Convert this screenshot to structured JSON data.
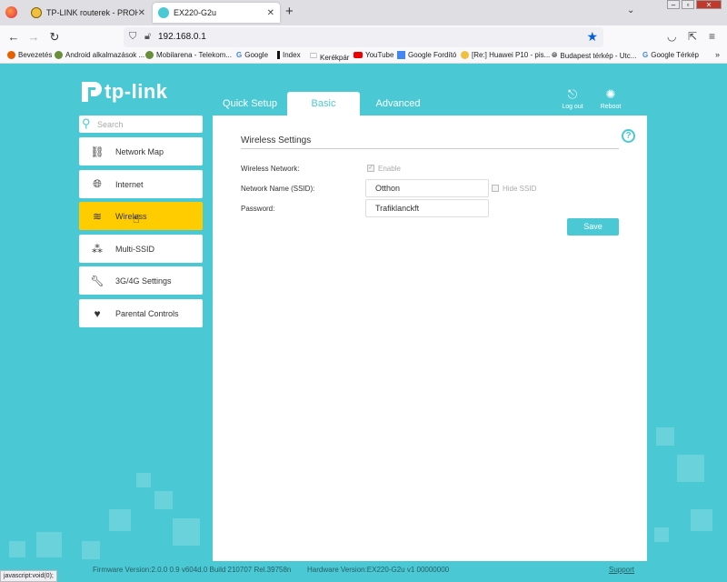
{
  "browser": {
    "tabs": [
      {
        "title": "TP-LINK routerek - PROHARDVER",
        "active": false
      },
      {
        "title": "EX220-G2u",
        "active": true
      }
    ],
    "new_tab": "+",
    "url": "192.168.0.1",
    "bookmarks": [
      {
        "label": "Bevezetés",
        "icon": "firefox-icon"
      },
      {
        "label": "Android alkalmazások ...",
        "icon": "mobilarena-icon"
      },
      {
        "label": "Mobilarena - Telekom...",
        "icon": "mobilarena-icon"
      },
      {
        "label": "Google",
        "icon": "google-icon"
      },
      {
        "label": "Index",
        "icon": "index-icon"
      },
      {
        "label": "Kerékpár",
        "icon": "folder-icon"
      },
      {
        "label": "YouTube",
        "icon": "youtube-icon"
      },
      {
        "label": "Google Fordító",
        "icon": "translate-icon"
      },
      {
        "label": "[Re:] Huawei P10 - pis...",
        "icon": "mobilarena-icon"
      },
      {
        "label": "Budapest térkép - Utc...",
        "icon": "globe-icon"
      },
      {
        "label": "Google Térkép",
        "icon": "google-icon"
      }
    ],
    "status_text": "javascript:void(0);"
  },
  "router": {
    "brand": "tp-link",
    "nav_tabs": [
      {
        "label": "Quick Setup",
        "active": false
      },
      {
        "label": "Basic",
        "active": true
      },
      {
        "label": "Advanced",
        "active": false
      }
    ],
    "logout_label": "Log out",
    "reboot_label": "Reboot",
    "search_placeholder": "Search",
    "sidebar": [
      {
        "label": "Network Map",
        "icon": "network-map-icon",
        "active": false
      },
      {
        "label": "Internet",
        "icon": "globe-icon",
        "active": false
      },
      {
        "label": "Wireless",
        "icon": "wifi-icon",
        "active": true
      },
      {
        "label": "Multi-SSID",
        "icon": "multi-ssid-icon",
        "active": false
      },
      {
        "label": "3G/4G Settings",
        "icon": "wrench-icon",
        "active": false
      },
      {
        "label": "Parental Controls",
        "icon": "heart-icon",
        "active": false
      }
    ],
    "section_title": "Wireless Settings",
    "fields": {
      "wireless_network_label": "Wireless Network:",
      "enable_label": "Enable",
      "enable_checked": true,
      "ssid_label": "Network Name (SSID):",
      "ssid_value": "Otthon",
      "hide_ssid_label": "Hide SSID",
      "hide_ssid_checked": false,
      "password_label": "Password:",
      "password_value": "Trafiklanckft"
    },
    "save_label": "Save",
    "footer": {
      "firmware": "Firmware Version:2.0.0 0.9 v604d.0 Build 210707 Rel.39758n",
      "hardware": "Hardware Version:EX220-G2u v1 00000000",
      "support": "Support"
    }
  }
}
